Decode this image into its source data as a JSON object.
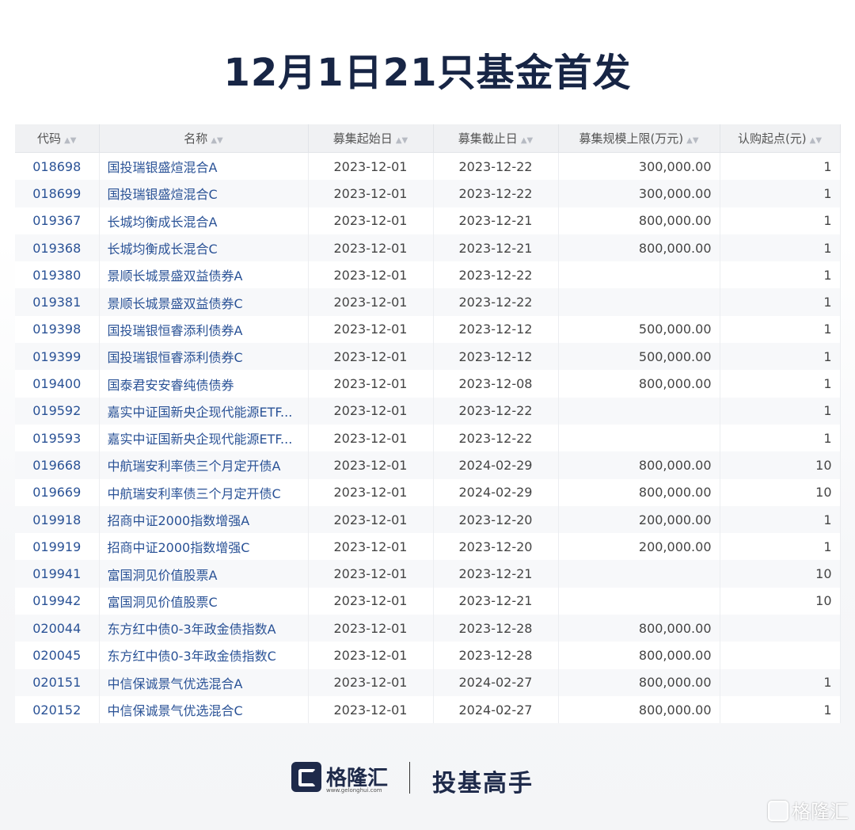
{
  "title": "12月1日21只基金首发",
  "columns": [
    "代码",
    "名称",
    "募集起始日",
    "募集截止日",
    "募集规模上限(万元)",
    "认购起点(元)"
  ],
  "rows": [
    {
      "code": "018698",
      "name": "国投瑞银盛煊混合A",
      "start": "2023-12-01",
      "end": "2023-12-22",
      "cap": "300,000.00",
      "min": "1"
    },
    {
      "code": "018699",
      "name": "国投瑞银盛煊混合C",
      "start": "2023-12-01",
      "end": "2023-12-22",
      "cap": "300,000.00",
      "min": "1"
    },
    {
      "code": "019367",
      "name": "长城均衡成长混合A",
      "start": "2023-12-01",
      "end": "2023-12-21",
      "cap": "800,000.00",
      "min": "1"
    },
    {
      "code": "019368",
      "name": "长城均衡成长混合C",
      "start": "2023-12-01",
      "end": "2023-12-21",
      "cap": "800,000.00",
      "min": "1"
    },
    {
      "code": "019380",
      "name": "景顺长城景盛双益债券A",
      "start": "2023-12-01",
      "end": "2023-12-22",
      "cap": "",
      "min": "1"
    },
    {
      "code": "019381",
      "name": "景顺长城景盛双益债券C",
      "start": "2023-12-01",
      "end": "2023-12-22",
      "cap": "",
      "min": "1"
    },
    {
      "code": "019398",
      "name": "国投瑞银恒睿添利债券A",
      "start": "2023-12-01",
      "end": "2023-12-12",
      "cap": "500,000.00",
      "min": "1"
    },
    {
      "code": "019399",
      "name": "国投瑞银恒睿添利债券C",
      "start": "2023-12-01",
      "end": "2023-12-12",
      "cap": "500,000.00",
      "min": "1"
    },
    {
      "code": "019400",
      "name": "国泰君安安睿纯债债券",
      "start": "2023-12-01",
      "end": "2023-12-08",
      "cap": "800,000.00",
      "min": "1"
    },
    {
      "code": "019592",
      "name": "嘉实中证国新央企现代能源ETF...",
      "start": "2023-12-01",
      "end": "2023-12-22",
      "cap": "",
      "min": "1"
    },
    {
      "code": "019593",
      "name": "嘉实中证国新央企现代能源ETF...",
      "start": "2023-12-01",
      "end": "2023-12-22",
      "cap": "",
      "min": "1"
    },
    {
      "code": "019668",
      "name": "中航瑞安利率债三个月定开债A",
      "start": "2023-12-01",
      "end": "2024-02-29",
      "cap": "800,000.00",
      "min": "10"
    },
    {
      "code": "019669",
      "name": "中航瑞安利率债三个月定开债C",
      "start": "2023-12-01",
      "end": "2024-02-29",
      "cap": "800,000.00",
      "min": "10"
    },
    {
      "code": "019918",
      "name": "招商中证2000指数增强A",
      "start": "2023-12-01",
      "end": "2023-12-20",
      "cap": "200,000.00",
      "min": "1"
    },
    {
      "code": "019919",
      "name": "招商中证2000指数增强C",
      "start": "2023-12-01",
      "end": "2023-12-20",
      "cap": "200,000.00",
      "min": "1"
    },
    {
      "code": "019941",
      "name": "富国洞见价值股票A",
      "start": "2023-12-01",
      "end": "2023-12-21",
      "cap": "",
      "min": "10"
    },
    {
      "code": "019942",
      "name": "富国洞见价值股票C",
      "start": "2023-12-01",
      "end": "2023-12-21",
      "cap": "",
      "min": "10"
    },
    {
      "code": "020044",
      "name": "东方红中债0-3年政金债指数A",
      "start": "2023-12-01",
      "end": "2023-12-28",
      "cap": "800,000.00",
      "min": ""
    },
    {
      "code": "020045",
      "name": "东方红中债0-3年政金债指数C",
      "start": "2023-12-01",
      "end": "2023-12-28",
      "cap": "800,000.00",
      "min": ""
    },
    {
      "code": "020151",
      "name": "中信保诚景气优选混合A",
      "start": "2023-12-01",
      "end": "2024-02-27",
      "cap": "800,000.00",
      "min": "1"
    },
    {
      "code": "020152",
      "name": "中信保诚景气优选混合C",
      "start": "2023-12-01",
      "end": "2024-02-27",
      "cap": "800,000.00",
      "min": "1"
    }
  ],
  "footer": {
    "logo_text": "格隆汇",
    "logo_url": "www.gelonghui.com",
    "slogan": "投基高手",
    "watermark": "格隆汇"
  },
  "colors": {
    "title": "#172545",
    "link": "#2a5296",
    "header_bg": "#f0f1f3",
    "stripe": "#f7f8fa"
  },
  "icons": [
    "sort-icon",
    "gelonghui-logo-icon"
  ]
}
